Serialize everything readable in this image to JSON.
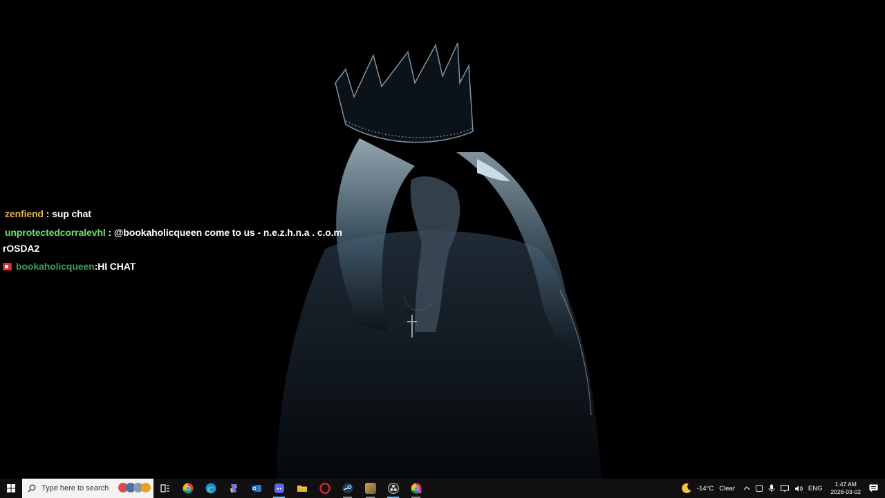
{
  "chat": {
    "messages": [
      {
        "user": "zenfiend",
        "user_color": "#e0b34a",
        "separator": " : ",
        "text": "sup chat"
      },
      {
        "user": "unprotectedcorralevhl",
        "user_color": "#69e36b",
        "separator": " : ",
        "text": "@bookaholicqueen come to us - n.e.z.h.n.a . c.o.m",
        "text_cont": "rOSDA2"
      },
      {
        "user": "bookaholicqueen",
        "user_color": "#3b9c5c",
        "separator": " : ",
        "text": "HI CHAT",
        "badge": "broadcaster-icon"
      }
    ]
  },
  "taskbar": {
    "search_placeholder": "Type here to search",
    "apps": [
      {
        "name": "task-view-icon"
      },
      {
        "name": "chrome-icon"
      },
      {
        "name": "edge-icon"
      },
      {
        "name": "copilot-icon"
      },
      {
        "name": "outlook-icon"
      },
      {
        "name": "discord-icon"
      },
      {
        "name": "file-explorer-icon"
      },
      {
        "name": "opera-icon"
      },
      {
        "name": "steam-icon"
      },
      {
        "name": "app-icon"
      },
      {
        "name": "obs-icon"
      },
      {
        "name": "chrome-profile-icon"
      }
    ],
    "weather": {
      "temp": "-14°C",
      "condition": "Clear"
    },
    "language": "ENG",
    "time": "1:47 AM",
    "date": "2026-03-02"
  }
}
